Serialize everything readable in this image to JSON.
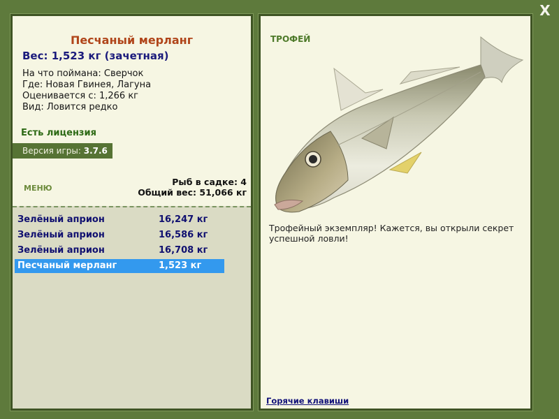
{
  "window": {
    "close_label": "X"
  },
  "fish": {
    "name": "Песчаный мерланг",
    "weight_line": "Вес: 1,523 кг (зачетная)",
    "bait": "На что поймана: Сверчок",
    "location": "Где: Новая Гвинея, Лагуна",
    "rated_from": "Оценивается с: 1,266 кг",
    "species_note": "Вид: Ловится редко"
  },
  "license": "Есть лицензия",
  "version": {
    "label": "Версия игры: ",
    "number": "3.7.6"
  },
  "menu_label": "МЕНЮ",
  "stats": {
    "fish_count": "Рыб в садке: 4",
    "total_weight": "Общий вес: 51,066 кг"
  },
  "catch_list": [
    {
      "name": "Зелёный априон",
      "weight": "16,247 кг",
      "selected": false
    },
    {
      "name": "Зелёный априон",
      "weight": "16,586 кг",
      "selected": false
    },
    {
      "name": "Зелёный априон",
      "weight": "16,708 кг",
      "selected": false
    },
    {
      "name": "Песчаный мерланг",
      "weight": "1,523 кг",
      "selected": true
    }
  ],
  "trophy": {
    "label": "ТРОФЕЙ",
    "description": "Трофейный экземпляр! Кажется, вы открыли секрет успешной ловли!",
    "fish_image": "whiting-fish-illustration"
  },
  "hotkeys": "Горячие клавиши",
  "colors": {
    "frame": "#5e7a3c",
    "panel": "#f6f6e3",
    "title": "#b0451a",
    "selected_row": "#3399ee"
  }
}
